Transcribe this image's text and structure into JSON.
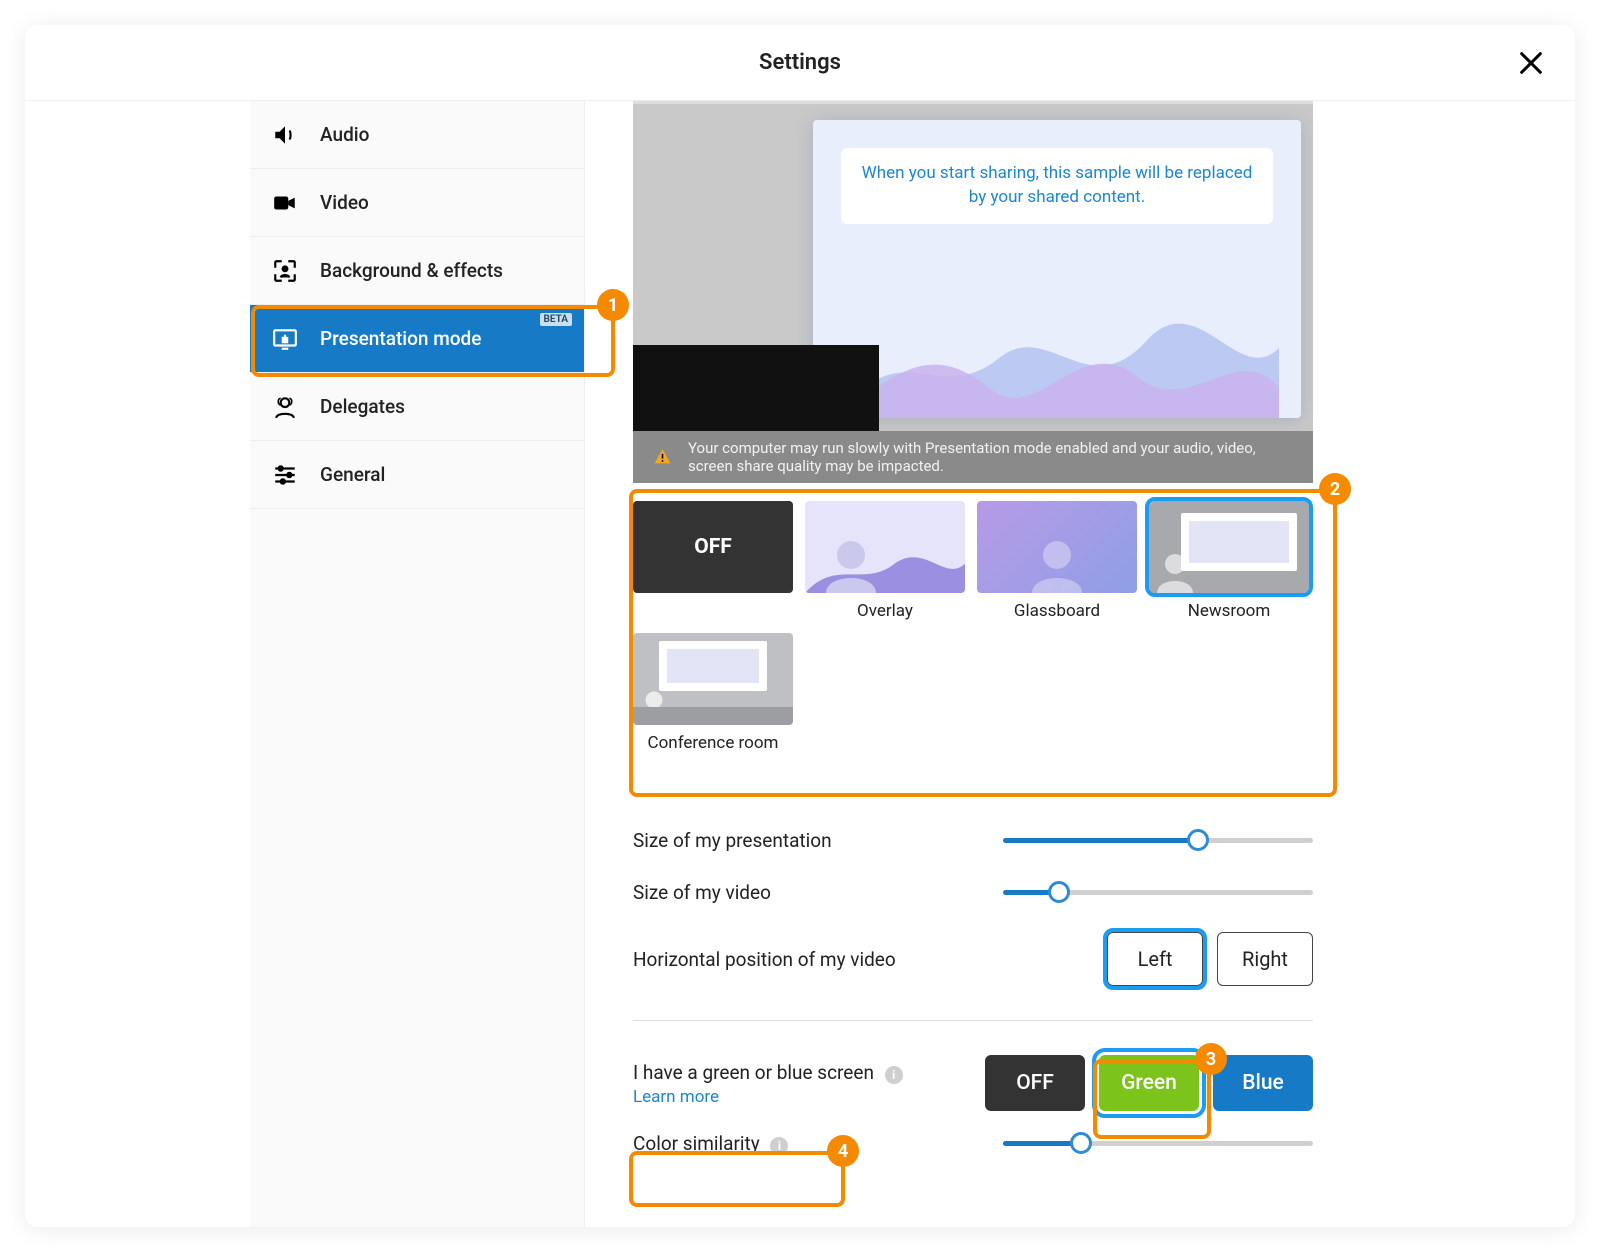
{
  "title": "Settings",
  "sidebar": {
    "items": [
      {
        "label": "Audio"
      },
      {
        "label": "Video"
      },
      {
        "label": "Background & effects"
      },
      {
        "label": "Presentation mode",
        "badge": "BETA"
      },
      {
        "label": "Delegates"
      },
      {
        "label": "General"
      }
    ]
  },
  "preview": {
    "message": "When you start sharing, this sample will be replaced by your shared content.",
    "warning": "Your computer may run slowly with Presentation mode enabled and your audio, video, screen share quality may be impacted."
  },
  "modes": {
    "off": "OFF",
    "overlay": "Overlay",
    "glassboard": "Glassboard",
    "newsroom": "Newsroom",
    "conference": "Conference room",
    "selected": "newsroom"
  },
  "sliders": {
    "presentation_size": {
      "label": "Size of my presentation",
      "percent": 63
    },
    "video_size": {
      "label": "Size of my video",
      "percent": 18
    },
    "color_similarity": {
      "label": "Color similarity",
      "percent": 25
    }
  },
  "hpos": {
    "label": "Horizontal position of my video",
    "left": "Left",
    "right": "Right",
    "selected": "left"
  },
  "chroma": {
    "label": "I have a green or blue screen",
    "learn": "Learn more",
    "off": "OFF",
    "green": "Green",
    "blue": "Blue",
    "selected": "green"
  },
  "annotations": {
    "a1": "1",
    "a2": "2",
    "a3": "3",
    "a4": "4"
  }
}
